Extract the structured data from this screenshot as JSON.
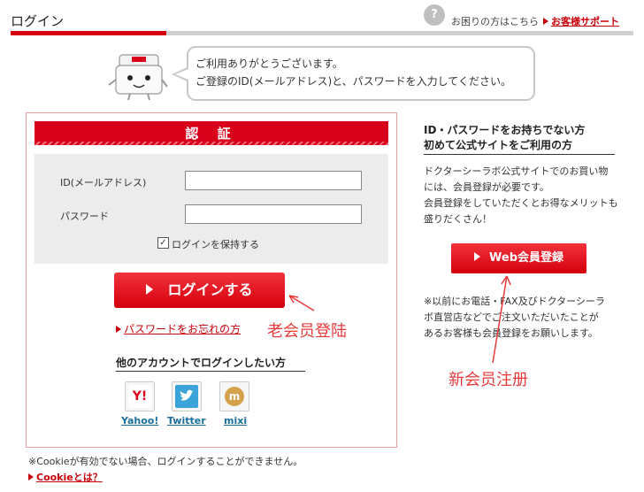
{
  "header": {
    "title": "ログイン",
    "help_text": "お困りの方はこちら",
    "support_link": "お客様サポート"
  },
  "greeting": {
    "line1": "ご利用ありがとうございます。",
    "line2": "ご登録のID(メールアドレス)と、パスワードを入力してください。"
  },
  "login": {
    "auth_title": "認 証",
    "id_label": "ID(メールアドレス)",
    "id_value": "",
    "password_label": "パスワード",
    "password_value": "",
    "keep_login_label": "ログインを保持する",
    "keep_login_checked": true,
    "login_button": "ログインする",
    "forgot_link": "パスワードをお忘れの方",
    "other_heading": "他のアカウントでログインしたい方",
    "social": [
      {
        "label": "Yahoo!",
        "glyph": "Y!",
        "color": "#ffffff",
        "icon": "yahoo-icon"
      },
      {
        "label": "Twitter",
        "glyph": "🐦",
        "color": "#3aa3d8",
        "icon": "twitter-icon"
      },
      {
        "label": "mixi",
        "glyph": "m",
        "color": "#d4a24a",
        "icon": "mixi-icon"
      }
    ]
  },
  "footer": {
    "cookie_note": "※Cookieが有効でない場合、ログインすることができません。",
    "cookie_link": "Cookieとは？"
  },
  "register": {
    "heading_line1": "ID・パスワードをお持ちでない方",
    "heading_line2": "初めて公式サイトをご利用の方",
    "text": [
      "ドクターシーラボ公式サイトでのお買い物",
      "には、会員登録が必要です。",
      "会員登録をしていただくとお得なメリットも",
      "盛りだくさん！"
    ],
    "button": "Web会員登録",
    "note": [
      "※以前にお電話・FAX及びドクターシーラ",
      "ボ直営店などでご注文いただいたことが",
      "あるお客様も会員登録をお願いします。"
    ]
  },
  "annotations": {
    "old_member": "老会员登陆",
    "new_member": "新会员注册"
  },
  "colors": {
    "accent": "#d8001a",
    "annotation": "#e63a3a"
  }
}
